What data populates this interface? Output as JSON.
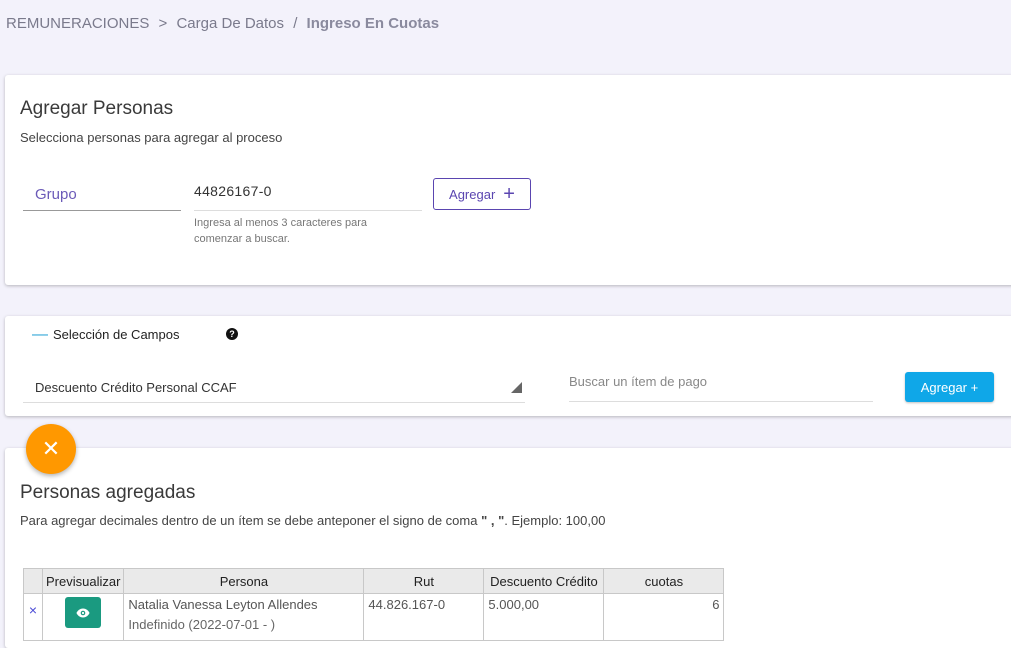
{
  "breadcrumb": {
    "root": "REMUNERACIONES",
    "sep1": ">",
    "middle": "Carga De Datos",
    "sep2": "/",
    "current": "Ingreso En Cuotas"
  },
  "add_people": {
    "title": "Agregar Personas",
    "subtitle": "Selecciona personas para agregar al proceso",
    "group_label": "Grupo",
    "rut_value": "44826167-0",
    "hint": "Ingresa al menos 3 caracteres para comenzar a buscar.",
    "add_button": "Agregar",
    "add_icon": "+"
  },
  "fields": {
    "collapse_icon": "—",
    "title": "Selección de Campos",
    "help_icon": "?",
    "selected_item": "Descuento Crédito Personal CCAF",
    "search_placeholder": "Buscar un ítem de pago",
    "add_button": "Agregar +"
  },
  "fab": {
    "icon": "✕"
  },
  "added": {
    "title": "Personas agregadas",
    "note_prefix": "Para agregar decimales dentro de un ítem se debe anteponer el signo de coma ",
    "note_sign": "\" , \"",
    "note_suffix": ". Ejemplo: 100,00",
    "columns": [
      "",
      "Previsualizar",
      "Persona",
      "Rut",
      "Descuento Crédito",
      "cuotas"
    ],
    "rows": [
      {
        "delete": "×",
        "name": "Natalia Vanessa Leyton Allendes",
        "period": "Indefinido (2022-07-01 - )",
        "rut": "44.826.167-0",
        "descuento": "5.000,00",
        "cuotas": "6"
      }
    ]
  },
  "colors": {
    "primary": "#5a45b0",
    "accent": "#0fa7e8",
    "fab": "#ff9800",
    "preview": "#1a9a80"
  }
}
